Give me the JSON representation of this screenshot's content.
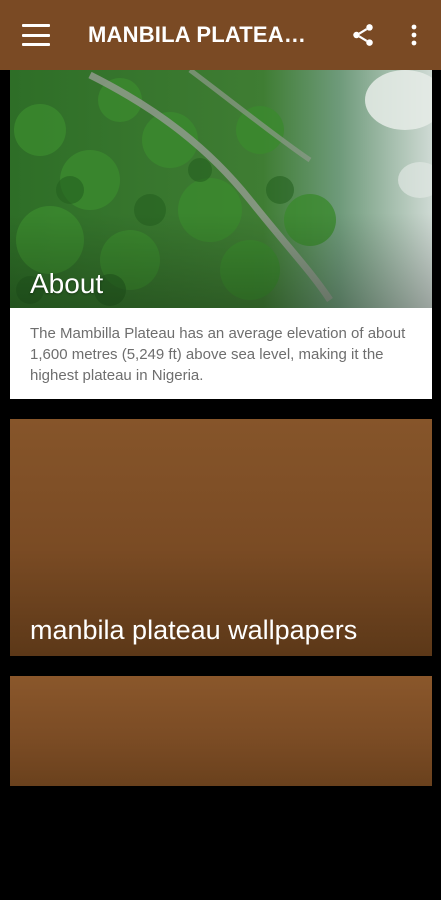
{
  "appbar": {
    "title": "MANBILA PLATEAU WALLPAPERS",
    "icons": {
      "menu": "menu-icon",
      "share": "share-icon",
      "more": "more-vert-icon"
    },
    "color": "#7a4a24"
  },
  "cards": {
    "about": {
      "title": "About",
      "text": "The Mambilla Plateau has an average elevation of about 1,600 metres (5,249 ft) above sea level, making it the highest plateau in Nigeria."
    },
    "wallpapers": {
      "title": "manbila plateau wallpapers"
    }
  },
  "colors": {
    "card_brown": "#7a4b24",
    "background": "#000000"
  }
}
